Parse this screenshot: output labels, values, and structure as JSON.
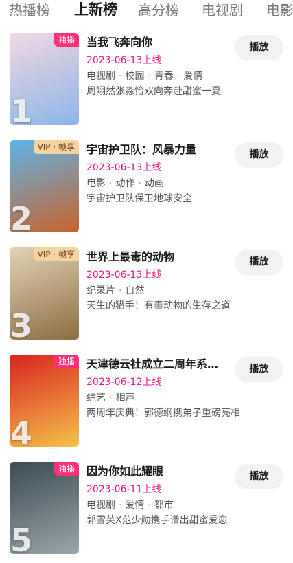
{
  "tabs": [
    {
      "label": "热播榜",
      "active": false
    },
    {
      "label": "上新榜",
      "active": true
    },
    {
      "label": "高分榜",
      "active": false
    },
    {
      "label": "电视剧",
      "active": false
    },
    {
      "label": "电影",
      "active": false
    }
  ],
  "play_label": "播放",
  "items": [
    {
      "rank": "1",
      "badge": "独播",
      "badge_type": "exclusive",
      "title": "当我飞奔向你",
      "date": "2023-06-13上线",
      "tags": [
        "电视剧",
        "校园",
        "青春",
        "爱情"
      ],
      "desc": "周翊然张淼怡双向奔赴甜蜜一夏",
      "poster_colors": [
        "#f3d7e3",
        "#8ab6e6"
      ]
    },
    {
      "rank": "2",
      "badge": "VIP · 帧享",
      "badge_type": "vip",
      "title": "宇宙护卫队：风暴力量",
      "date": "2023-06-13上线",
      "tags": [
        "电影",
        "动作",
        "动画"
      ],
      "desc": "宇宙护卫队保卫地球安全",
      "poster_colors": [
        "#5fb3e8",
        "#c7642d"
      ]
    },
    {
      "rank": "3",
      "badge": "VIP · 帧享",
      "badge_type": "vip",
      "title": "世界上最毒的动物",
      "date": "2023-06-13上线",
      "tags": [
        "纪录片",
        "自然"
      ],
      "desc": "天生的猎手！有毒动物的生存之道",
      "poster_colors": [
        "#e3d3b5",
        "#8c6d43"
      ]
    },
    {
      "rank": "4",
      "badge": "独播",
      "badge_type": "exclusive",
      "title": "天津德云社成立二周年系…",
      "date": "2023-06-12上线",
      "tags": [
        "综艺",
        "相声"
      ],
      "desc": "两周年庆典！郭德纲携弟子重磅亮相",
      "poster_colors": [
        "#d8231f",
        "#f5c24b"
      ]
    },
    {
      "rank": "5",
      "badge": "独播",
      "badge_type": "exclusive",
      "title": "因为你如此耀眼",
      "date": "2023-06-11上线",
      "tags": [
        "电视剧",
        "爱情",
        "都市"
      ],
      "desc": "郭雪芙X范少勋携手谱出甜蜜爱恋",
      "poster_colors": [
        "#3b4a54",
        "#9aa6a8"
      ]
    }
  ]
}
